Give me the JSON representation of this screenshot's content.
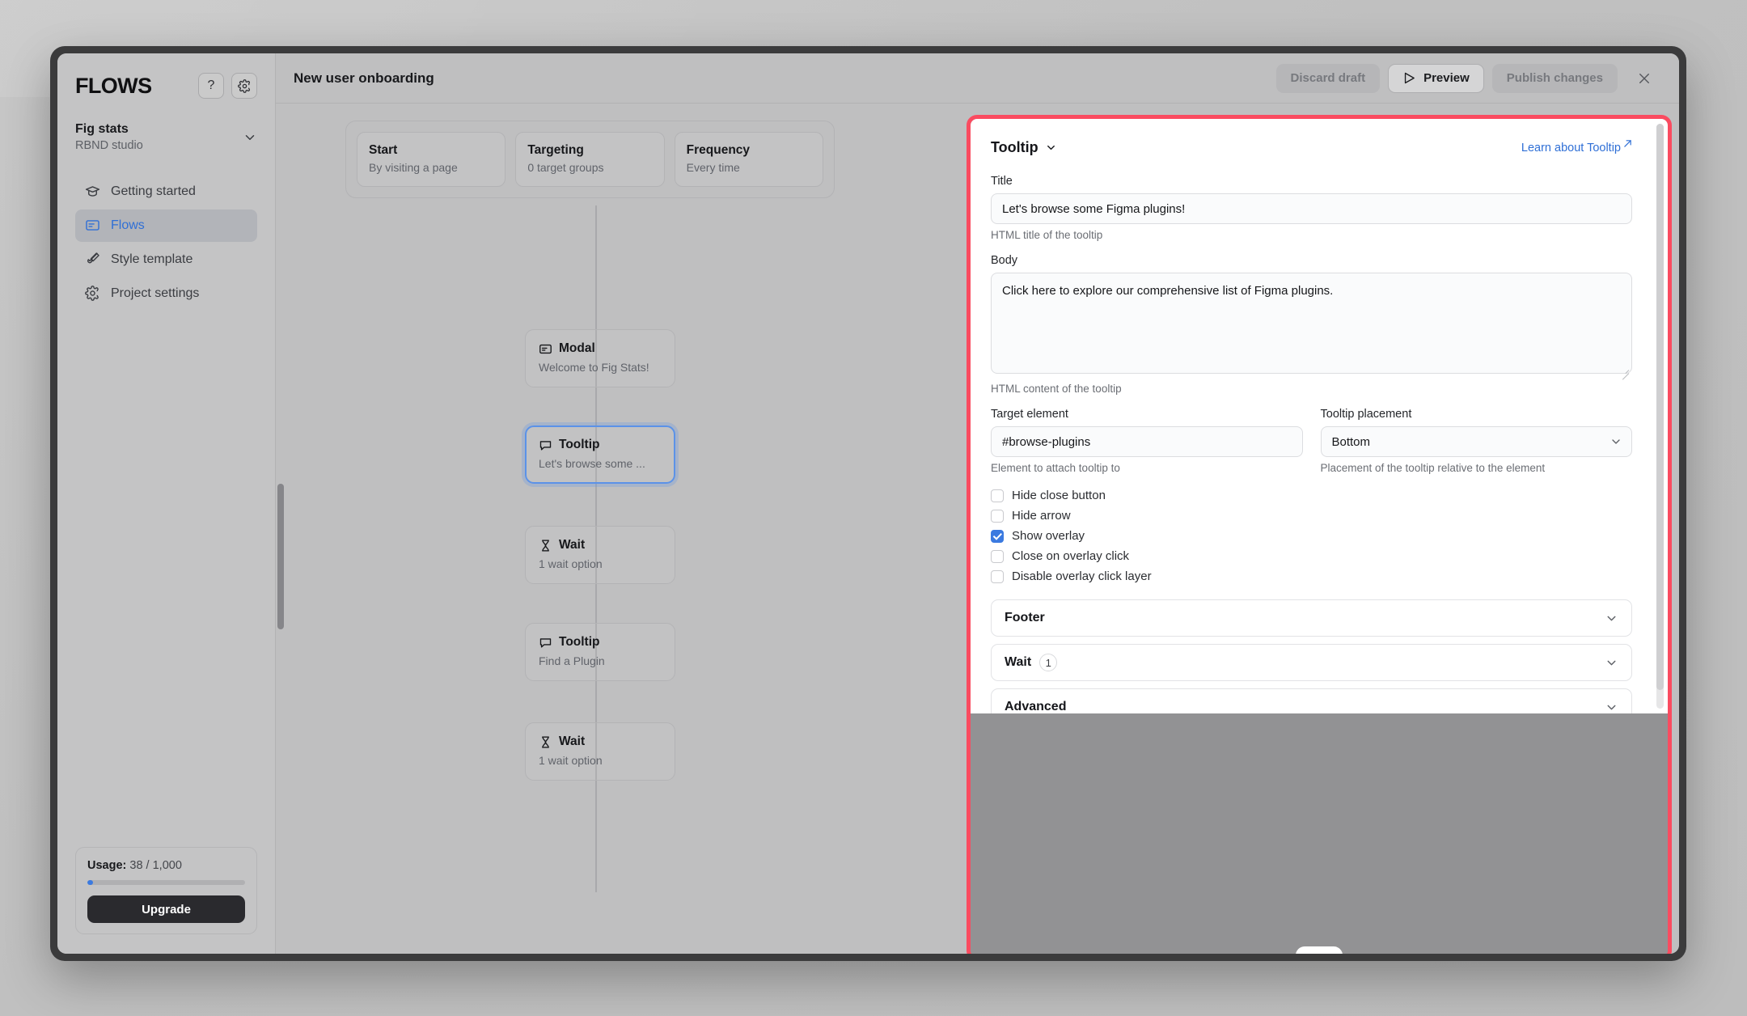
{
  "sidebar": {
    "brand": "FLOWS",
    "help_label": "?",
    "settings_icon": "gear-icon",
    "workspace": {
      "name": "Fig stats",
      "subtitle": "RBND studio"
    },
    "nav_items": [
      {
        "label": "Getting started",
        "icon": "graduation-cap-icon",
        "active": false
      },
      {
        "label": "Flows",
        "icon": "flow-card-icon",
        "active": true
      },
      {
        "label": "Style template",
        "icon": "paintbrush-icon",
        "active": false
      },
      {
        "label": "Project settings",
        "icon": "gear-icon",
        "active": false
      }
    ],
    "usage": {
      "label": "Usage:",
      "value": "38 / 1,000",
      "percent": 3.8,
      "upgrade_label": "Upgrade"
    }
  },
  "topbar": {
    "title": "New user onboarding",
    "discard_label": "Discard draft",
    "preview_label": "Preview",
    "publish_label": "Publish changes",
    "close_icon": "close-icon"
  },
  "canvas": {
    "entry_cards": [
      {
        "title": "Start",
        "subtitle": "By visiting a page"
      },
      {
        "title": "Targeting",
        "subtitle": "0 target groups"
      },
      {
        "title": "Frequency",
        "subtitle": "Every time"
      }
    ],
    "nodes": [
      {
        "title": "Modal",
        "subtitle": "Welcome to Fig Stats!",
        "icon": "modal-icon",
        "selected": false
      },
      {
        "title": "Tooltip",
        "subtitle": "Let's browse some ...",
        "icon": "tooltip-icon",
        "selected": true
      },
      {
        "title": "Wait",
        "subtitle": "1 wait option",
        "icon": "hourglass-icon",
        "selected": false
      },
      {
        "title": "Tooltip",
        "subtitle": "Find a Plugin",
        "icon": "tooltip-icon",
        "selected": false
      },
      {
        "title": "Wait",
        "subtitle": "1 wait option",
        "icon": "hourglass-icon",
        "selected": false
      }
    ]
  },
  "panel": {
    "type_label": "Tooltip",
    "learn_link": "Learn about Tooltip",
    "title_field": {
      "label": "Title",
      "value": "Let's browse some Figma plugins!",
      "hint": "HTML title of the tooltip"
    },
    "body_field": {
      "label": "Body",
      "value": "Click here to explore our comprehensive list of Figma plugins.",
      "hint": "HTML content of the tooltip"
    },
    "target_field": {
      "label": "Target element",
      "value": "#browse-plugins",
      "hint": "Element to attach tooltip to"
    },
    "placement_field": {
      "label": "Tooltip placement",
      "value": "Bottom",
      "hint": "Placement of the tooltip relative to the element"
    },
    "checkboxes": [
      {
        "label": "Hide close button",
        "checked": false
      },
      {
        "label": "Hide arrow",
        "checked": false
      },
      {
        "label": "Show overlay",
        "checked": true
      },
      {
        "label": "Close on overlay click",
        "checked": false
      },
      {
        "label": "Disable overlay click layer",
        "checked": false
      }
    ],
    "accordions": [
      {
        "title": "Footer",
        "badge": ""
      },
      {
        "title": "Wait",
        "badge": "1"
      },
      {
        "title": "Advanced",
        "badge": ""
      }
    ]
  },
  "colors": {
    "highlight": "#fa4b60",
    "accent": "#2f6fd6",
    "checkbox_checked": "#3b7ae0",
    "node_selected": "#5b92e8"
  }
}
